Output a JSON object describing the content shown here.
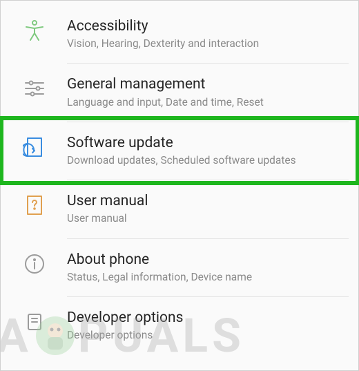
{
  "settings": {
    "items": [
      {
        "key": "accessibility",
        "title": "Accessibility",
        "subtitle": "Vision, Hearing, Dexterity and interaction",
        "icon_color": "#7fc97f"
      },
      {
        "key": "general-management",
        "title": "General management",
        "subtitle": "Language and input, Date and time, Reset",
        "icon_color": "#9b9b9b"
      },
      {
        "key": "software-update",
        "title": "Software update",
        "subtitle": "Download updates, Scheduled software updates",
        "icon_color": "#3a8de0",
        "highlighted": true
      },
      {
        "key": "user-manual",
        "title": "User manual",
        "subtitle": "User manual",
        "icon_color": "#e0a050"
      },
      {
        "key": "about-phone",
        "title": "About phone",
        "subtitle": "Status, Legal information, Device name",
        "icon_color": "#9b9b9b"
      },
      {
        "key": "developer-options",
        "title": "Developer options",
        "subtitle": "Developer options",
        "icon_color": "#9b9b9b"
      }
    ]
  },
  "highlight": {
    "color": "#1eb61e"
  },
  "watermark": {
    "text_left": "A",
    "text_right": "PUALS"
  }
}
